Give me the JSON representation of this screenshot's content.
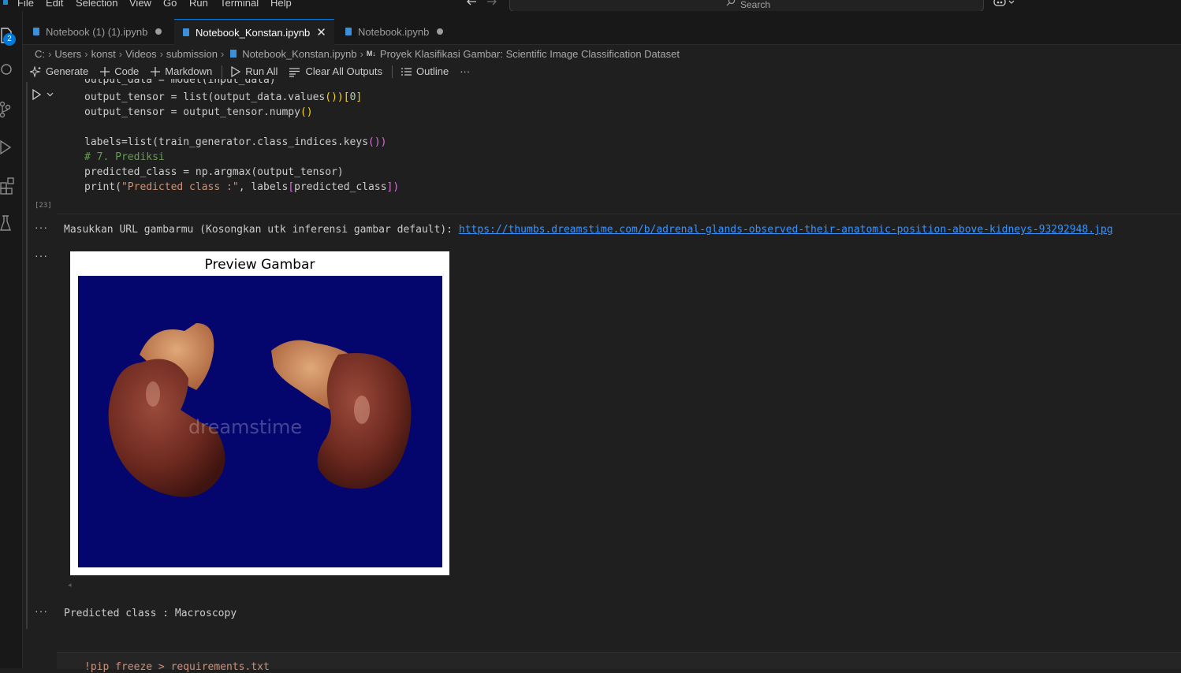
{
  "menu": [
    "File",
    "Edit",
    "Selection",
    "View",
    "Go",
    "Run",
    "Terminal",
    "Help"
  ],
  "search": {
    "placeholder": "Search"
  },
  "activity": {
    "badge": "2"
  },
  "tabs": [
    {
      "label": "Notebook (1) (1).ipynb",
      "dirty": true,
      "active": false
    },
    {
      "label": "Notebook_Konstan.ipynb",
      "dirty": false,
      "active": true
    },
    {
      "label": "Notebook.ipynb",
      "dirty": true,
      "active": false
    }
  ],
  "breadcrumb": {
    "items": [
      "C:",
      "Users",
      "konst",
      "Videos",
      "submission",
      "Notebook_Konstan.ipynb"
    ],
    "md_badge": "M↓",
    "section": "Proyek Klasifikasi Gambar: Scientific Image Classification Dataset"
  },
  "toolbar": {
    "generate": "Generate",
    "code": "Code",
    "markdown": "Markdown",
    "run_all": "Run All",
    "clear_all": "Clear All Outputs",
    "outline": "Outline",
    "more": "···"
  },
  "code_cell": {
    "lines": {
      "l0": "output_data = model(input_data)",
      "l1a": "output_tensor = list(output_data.values",
      "l1b": "())",
      "l1c": "[",
      "l1d": "0",
      "l1e": "]",
      "l2a": "output_tensor = output_tensor.numpy",
      "l2b": "()",
      "l3a": "labels=list(train_generator.class_indices.keys",
      "l3b": "())",
      "l4": "# 7. Prediksi",
      "l5": "predicted_class = np.argmax(output_tensor)",
      "l6a": "print(",
      "l6b": "\"Predicted class :\"",
      "l6c": ", labels",
      "l6d": "[",
      "l6e": "predicted_class",
      "l6f": "])"
    },
    "exec_count": "[23]"
  },
  "output1": {
    "prompt": "Masukkan URL gambarmu (Kosongkan utk inferensi gambar default): ",
    "url": "https://thumbs.dreamstime.com/b/adrenal-glands-observed-their-anatomic-position-above-kidneys-93292948.jpg"
  },
  "output_dots": "···",
  "plot": {
    "title": "Preview Gambar",
    "watermark": "dreamstime"
  },
  "output3": {
    "text": "Predicted class : Macroscopy"
  },
  "next_cell": {
    "code": "!pip freeze > requirements.txt"
  },
  "colors": {
    "accent": "#0078d4",
    "link": "#3794ff",
    "plot_bg": "#05056e"
  }
}
